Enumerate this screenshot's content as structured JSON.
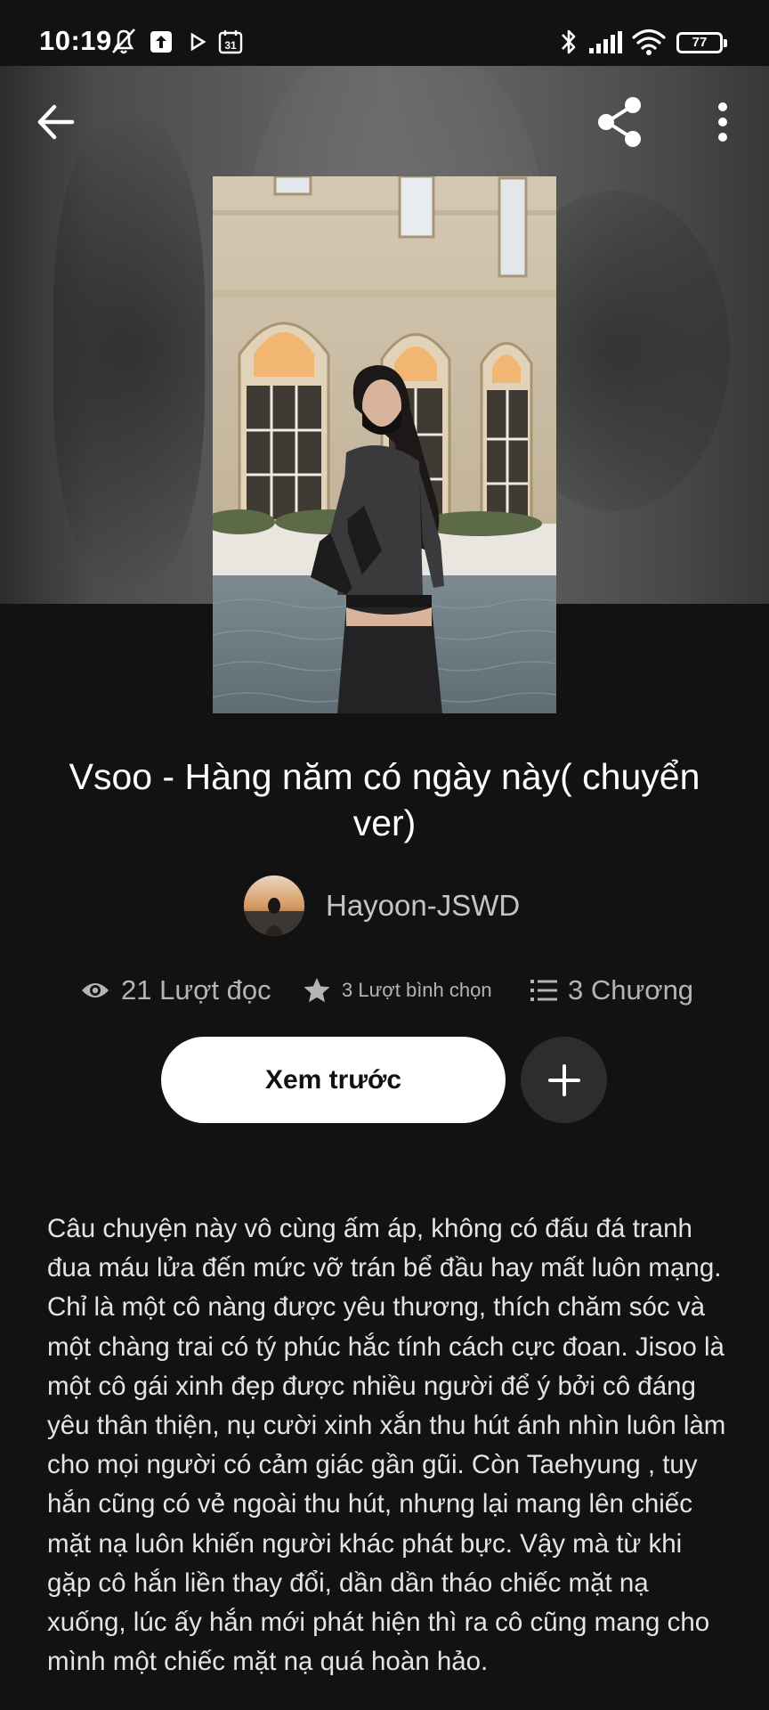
{
  "status_bar": {
    "time": "10:19",
    "battery": "77",
    "icons": [
      "bell-off-icon",
      "upload-icon",
      "play-icon",
      "calendar-icon",
      "bluetooth-icon",
      "signal-icon",
      "wifi-icon",
      "battery-icon"
    ]
  },
  "toolbar": {
    "back_icon": "arrow-left-icon",
    "share_icon": "share-icon",
    "more_icon": "more-vertical-icon"
  },
  "story": {
    "title": "Vsoo - Hàng năm có ngày này( chuyển ver)",
    "author": "Hayoon-JSWD",
    "stats": {
      "reads": "21 Lượt đọc",
      "votes": "3 Lượt bình chọn",
      "chapters": "3 Chương"
    },
    "preview_button": "Xem trước",
    "description": "Câu chuyện này vô cùng ấm áp, không có đấu đá tranh đua máu lửa đến mức vỡ trán bể đầu hay mất luôn mạng. Chỉ là một cô nàng được yêu thương, thích chăm sóc và một chàng trai có tý phúc hắc tính cách cực đoan. Jisoo là một cô gái xinh đẹp được nhiều người để ý bởi cô đáng yêu thân thiện, nụ cười xinh xắn thu hút ánh nhìn luôn làm cho mọi người có cảm giác gần gũi. Còn Taehyung , tuy hắn cũng có vẻ ngoài thu hút, nhưng lại mang lên chiếc mặt nạ luôn khiến người khác phát bực. Vậy mà từ khi gặp cô hắn liền thay đổi, dần dần tháo chiếc mặt nạ xuống, lúc ấy hắn mới phát hiện thì ra cô cũng mang cho mình một chiếc mặt nạ quá hoàn hảo."
  },
  "colors": {
    "background": "#121212",
    "primary_button": "#ffffff",
    "secondary_button": "#2d2d2d",
    "muted_text": "#b4b4b4"
  }
}
